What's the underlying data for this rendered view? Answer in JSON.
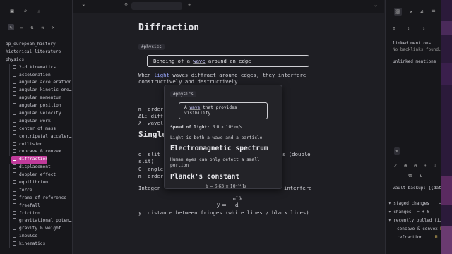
{
  "sidebar": {
    "icons": [
      "folder-icon",
      "search-icon",
      "star-icon"
    ],
    "toolbar_icons": [
      "new-note-icon",
      "new-folder-icon",
      "sort-icon",
      "collapse-icon",
      "edit-icon"
    ],
    "folders": [
      "ap_european_history",
      "historical_literature",
      "physics"
    ],
    "files": [
      "2-d kinematics",
      "acceleration",
      "angular acceleration",
      "angular kinetic ene…",
      "angular momentum",
      "angular position",
      "angular velocity",
      "angular work",
      "center of mass",
      "centripetal acceler…",
      "collision",
      "concave & convex",
      "diffraction",
      "displacement",
      "doppler effect",
      "equilibrium",
      "force",
      "frame of reference",
      "freefall",
      "friction",
      "gravitational poten…",
      "gravity & weight",
      "impulse",
      "kinematics"
    ],
    "selected": "diffraction"
  },
  "tabs": {
    "left_icon": "sidebar-toggle-icon",
    "pin_icon": "pin-icon",
    "add": "+",
    "menu": "⌄"
  },
  "note": {
    "title": "Diffraction",
    "tag": "#physics",
    "callout_pre": "Bending of a ",
    "callout_link": "wave",
    "callout_post": " around an edge",
    "line1_pre": "When ",
    "line1_link": "light",
    "line1_post": " waves diffract around edges, they interfere",
    "line2": "constructively and destructively",
    "var_m": "m: order",
    "var_dl": "ΔL: diff",
    "var_lambda": "λ: wavel",
    "h2": "Single",
    "d_line": "d: slit",
    "d_line_right": "s (double",
    "slit": "slit)",
    "theta": "θ: angle",
    "order": "m: order",
    "integer": "Integer",
    "integer_right": "interfere",
    "formula": "y = mLλ / d",
    "y_line": "y: distance between fringes (white lines / black lines)"
  },
  "popover": {
    "tag": "#physics",
    "callout_pre": "A ",
    "callout_link": "wave",
    "callout_post": " that provides",
    "callout_line2": "visibility",
    "speed_label": "Speed of light:",
    "speed_value": "3.0 × 10⁸ m/s",
    "line": "Light is both a wave and a particle",
    "h2a": "Electromagnetic spectrum",
    "em1": "Human eyes can only detect a small",
    "em2": "portion",
    "h2b": "Planck's constant",
    "planck": "h = 6.63 × 10⁻³⁴ Js"
  },
  "rightpanel": {
    "icons": [
      "link-icon",
      "outgoing-links-icon",
      "tag-icon",
      "outline-icon"
    ],
    "linked_mentions": "linked mentions",
    "no_backlinks": "No backlinks found.",
    "unlinked_mentions": "unlinked mentions",
    "vault_backup": "vault backup: {{date}}",
    "staged_changes": "staged changes",
    "staged_count": "0",
    "changes": "changes",
    "changes_count": "0",
    "recently_pulled": "recently pulled fi…",
    "pulled_files": [
      {
        "name": "concave & convex",
        "badge": "M"
      },
      {
        "name": "refraction",
        "badge": "M"
      }
    ]
  }
}
